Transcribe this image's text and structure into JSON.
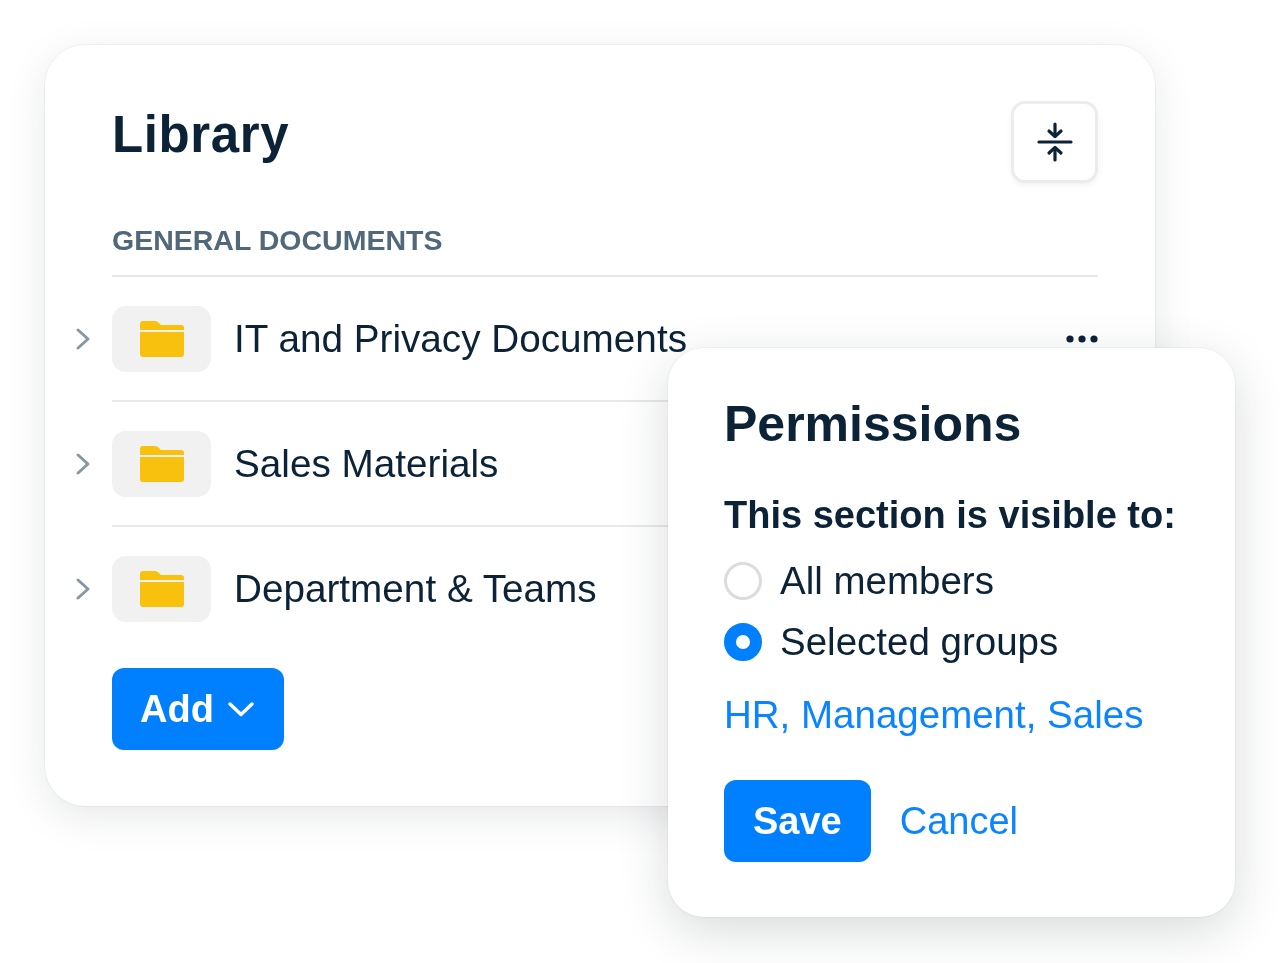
{
  "library": {
    "title": "Library",
    "section_heading": "GENERAL DOCUMENTS",
    "folders": [
      {
        "name": "IT and Privacy Documents",
        "expanded": false,
        "menu_visible": true
      },
      {
        "name": "Sales Materials",
        "expanded": false
      },
      {
        "name": "Department & Teams",
        "expanded": false
      }
    ],
    "add_button": {
      "label": "Add"
    }
  },
  "permissions": {
    "title": "Permissions",
    "prompt": "This section is visible to:",
    "options": [
      {
        "label": "All members",
        "selected": false
      },
      {
        "label": "Selected groups",
        "selected": true
      }
    ],
    "groups_link": "HR, Management, Sales",
    "buttons": [
      {
        "label": "Save",
        "kind": "primary"
      },
      {
        "label": "Cancel",
        "kind": "link"
      }
    ]
  }
}
